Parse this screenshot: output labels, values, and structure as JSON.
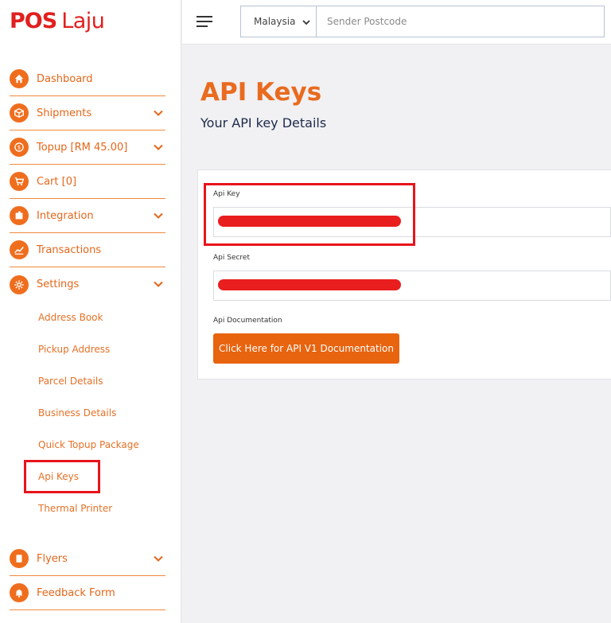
{
  "logo": {
    "pos": "POS",
    "laju": "Laju"
  },
  "nav": {
    "items": [
      {
        "label": "Dashboard",
        "icon": "home-icon"
      },
      {
        "label": "Shipments",
        "icon": "box-icon"
      },
      {
        "label": "Topup [RM 45.00]",
        "icon": "coin-icon"
      },
      {
        "label": "Cart [0]",
        "icon": "cart-icon"
      },
      {
        "label": "Integration",
        "icon": "puzzle-icon"
      },
      {
        "label": "Transactions",
        "icon": "chart-icon"
      },
      {
        "label": "Settings",
        "icon": "gear-icon"
      }
    ],
    "settings_sub": [
      "Address Book",
      "Pickup Address",
      "Parcel Details",
      "Business Details",
      "Quick Topup Package",
      "Api Keys",
      "Thermal Printer"
    ],
    "bottom_items": [
      {
        "label": "Flyers",
        "icon": "flyer-icon"
      },
      {
        "label": "Feedback Form",
        "icon": "bell-icon"
      }
    ]
  },
  "topbar": {
    "country_value": "Malaysia",
    "postcode_placeholder": "Sender Postcode"
  },
  "main": {
    "title": "API Keys",
    "subtitle": "Your API key Details",
    "api_key_label": "Api Key",
    "api_secret_label": "Api Secret",
    "api_doc_label": "Api Documentation",
    "doc_button": "Click Here for API V1 Documentation"
  },
  "colors": {
    "brand_orange": "#e96b1f",
    "logo_red": "#e0201f",
    "highlight_red": "#e8141b"
  }
}
